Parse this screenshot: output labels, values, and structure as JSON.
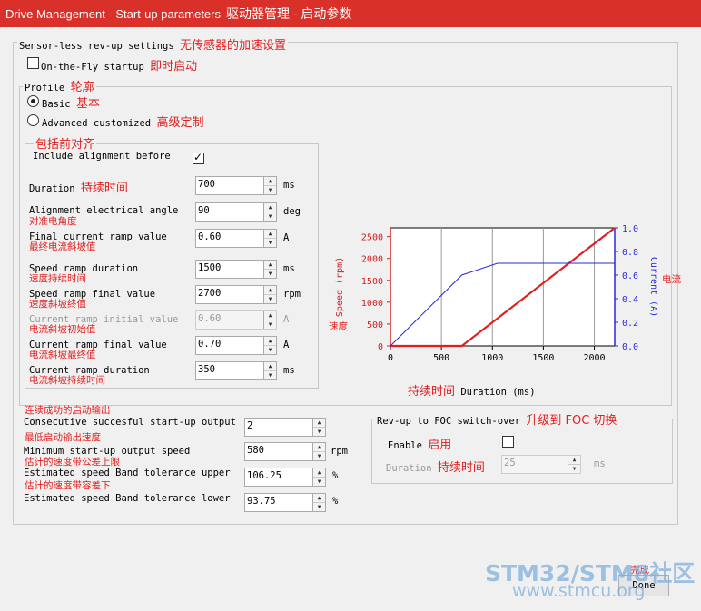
{
  "window": {
    "title": "Drive Management - Start-up parameters",
    "title_zh": "驱动器管理 - 启动参数"
  },
  "sensorless": {
    "label": "Sensor-less rev-up settings",
    "label_zh": "无传感器的加速设置",
    "on_the_fly": {
      "label": "On-the-Fly startup",
      "label_zh": "即时启动",
      "checked": false
    }
  },
  "profile": {
    "label": "Profile",
    "label_zh": "轮廓",
    "basic": {
      "label": "Basic",
      "label_zh": "基本",
      "selected": true
    },
    "advanced": {
      "label": "Advanced customized",
      "label_zh": "高级定制",
      "selected": false
    }
  },
  "alignment": {
    "label_zh": "包括前对齐",
    "include_label": "Include alignment before",
    "include_checked": true
  },
  "fields": [
    {
      "label": "Duration",
      "label_zh": "持续时间",
      "value": "700",
      "unit": "ms"
    },
    {
      "label": "Alignment electrical angle",
      "label_zh": "对准电角度",
      "value": "90",
      "unit": "deg"
    },
    {
      "label": "Final current ramp value",
      "label_zh": "最终电流斜坡值",
      "value": "0.60",
      "unit": "A"
    },
    {
      "label": "Speed ramp duration",
      "label_zh": "速度持续时间",
      "value": "1500",
      "unit": "ms"
    },
    {
      "label": "Speed ramp final value",
      "label_zh": "速度斜坡终值",
      "value": "2700",
      "unit": "rpm"
    },
    {
      "label": "Current ramp initial value",
      "label_zh": "电流斜坡初始值",
      "value": "0.60",
      "unit": "A",
      "disabled": true
    },
    {
      "label": "Current ramp final value",
      "label_zh": "电流斜坡最终值",
      "value": "0.70",
      "unit": "A"
    },
    {
      "label": "Current ramp duration",
      "label_zh": "电流斜坡持续时间",
      "value": "350",
      "unit": "ms"
    }
  ],
  "output": {
    "label_zh": "连续成功的启动输出",
    "fields": [
      {
        "label": "Consecutive succesful start-up output",
        "label_zh": "最低启动输出速度",
        "value": "2",
        "unit": ""
      },
      {
        "label": "Minimum start-up output speed",
        "label_zh": "估计的速度带公差上限",
        "value": "580",
        "unit": "rpm"
      },
      {
        "label": "Estimated speed Band tolerance upper",
        "label_zh": "估计的速度带容差下",
        "value": "106.25",
        "unit": "%"
      },
      {
        "label": "Estimated speed Band tolerance lower",
        "label_zh": "",
        "value": "93.75",
        "unit": "%"
      }
    ]
  },
  "foc": {
    "label": "Rev-up to FOC switch-over",
    "label_zh": "升级到 FOC 切换",
    "enable_label": "Enable",
    "enable_label_zh": "启用",
    "enable_checked": false,
    "duration_label": "Duration",
    "duration_label_zh": "持续时间",
    "duration_value": "25",
    "duration_unit": "ms"
  },
  "chart_data": {
    "type": "line",
    "xlabel": "Duration (ms)",
    "xlabel_zh": "持续时间",
    "ylabel_left": "Speed (rpm)",
    "ylabel_left_zh": "速度",
    "ylabel_right": "Current (A)",
    "ylabel_right_zh": "电流",
    "xlim": [
      0,
      2200
    ],
    "ylim_left": [
      0,
      2700
    ],
    "ylim_right": [
      0,
      1.0
    ],
    "x_ticks": [
      "0",
      "500",
      "1000",
      "1500",
      "2000"
    ],
    "y_left_ticks": [
      "0",
      "500",
      "1000",
      "1500",
      "2000",
      "2500"
    ],
    "y_right_ticks": [
      "0.0",
      "0.2",
      "0.4",
      "0.6",
      "0.8",
      "1.0"
    ],
    "grid": true,
    "series": [
      {
        "name": "Speed (rpm)",
        "color": "#e02020",
        "axis": "left",
        "x": [
          0,
          700,
          2200
        ],
        "y": [
          0,
          0,
          2700
        ]
      },
      {
        "name": "Current (A)",
        "color": "#2a2ad8",
        "axis": "right",
        "x": [
          0,
          700,
          1050,
          2200
        ],
        "y": [
          0,
          0.6,
          0.7,
          0.7
        ]
      }
    ]
  },
  "buttons": {
    "done": "Done",
    "done_zh": "完成"
  },
  "watermark": {
    "line1": "STM32/STM8社区",
    "line2": "www.stmcu.org"
  }
}
